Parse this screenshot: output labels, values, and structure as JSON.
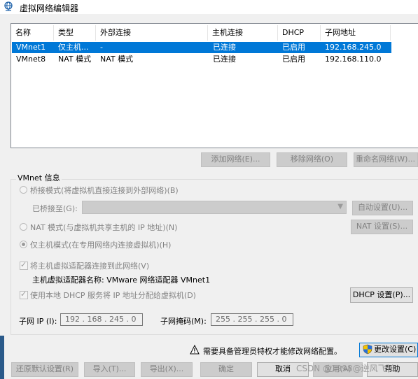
{
  "window": {
    "title": "虚拟网络编辑器"
  },
  "table": {
    "columns": [
      "名称",
      "类型",
      "外部连接",
      "主机连接",
      "DHCP",
      "子网地址"
    ],
    "rows": [
      {
        "name": "VMnet1",
        "type": "仅主机...",
        "external": "-",
        "host": "已连接",
        "dhcp": "已启用",
        "subnet": "192.168.245.0"
      },
      {
        "name": "VMnet8",
        "type": "NAT 模式",
        "external": "NAT 模式",
        "host": "已连接",
        "dhcp": "已启用",
        "subnet": "192.168.110.0"
      }
    ]
  },
  "table_buttons": {
    "add": "添加网络(E)...",
    "remove": "移除网络(O)",
    "rename": "重命名网络(W)..."
  },
  "vmnet_info": {
    "title": "VMnet 信息",
    "bridged_label": "桥接模式(将虚拟机直接连接到外部网络)(B)",
    "bridged_to_label": "已桥接至(G):",
    "bridged_to_value": "",
    "auto_settings": "自动设置(U)...",
    "nat_label": "NAT 模式(与虚拟机共享主机的 IP 地址)(N)",
    "nat_settings": "NAT 设置(S)...",
    "host_only_label": "仅主机模式(在专用网络内连接虚拟机)(H)",
    "connect_adapter_label": "将主机虚拟适配器连接到此网络(V)",
    "adapter_name_text": "主机虚拟适配器名称: VMware 网络适配器 VMnet1",
    "dhcp_label": "使用本地 DHCP 服务将 IP 地址分配给虚拟机(D)",
    "dhcp_settings": "DHCP 设置(P)...",
    "subnet_ip_label": "子网 IP (I):",
    "subnet_ip_value": "192 . 168 . 245 . 0",
    "subnet_mask_label": "子网掩码(M):",
    "subnet_mask_value": "255 . 255 . 255 . 0"
  },
  "admin_notice": "需要具备管理员特权才能修改网络配置。",
  "change_settings": "更改设置(C)",
  "footer": {
    "restore": "还原默认设置(R)",
    "import": "导入(T)...",
    "export": "导出(X)...",
    "ok": "确定",
    "cancel": "取消",
    "apply": "应用(A)",
    "help": "帮助"
  },
  "watermark": "CSDN @1998@逆风飞长"
}
